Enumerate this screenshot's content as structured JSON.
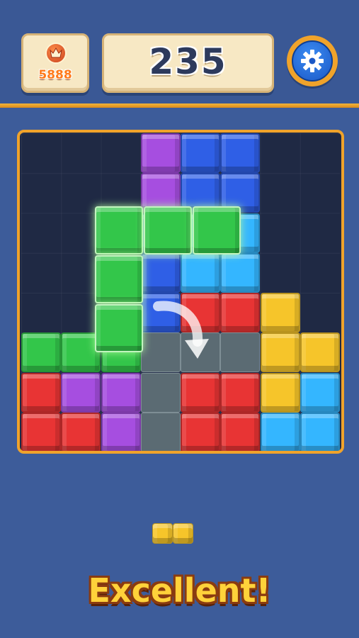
{
  "header": {
    "best_score": "5888",
    "score": "235",
    "crown_icon": "crown-icon",
    "settings_icon": "gear-icon"
  },
  "board": {
    "rows": 8,
    "cols": 8,
    "colors": {
      "purple": "#a64ee0",
      "blue": "#2f5fe6",
      "cyan": "#34b6ff",
      "red": "#e83434",
      "yellow": "#f6c52a",
      "green": "#33c64a"
    },
    "cells": [
      {
        "r": 0,
        "c": 3,
        "color": "purple"
      },
      {
        "r": 0,
        "c": 4,
        "color": "blue"
      },
      {
        "r": 0,
        "c": 5,
        "color": "blue"
      },
      {
        "r": 1,
        "c": 3,
        "color": "purple"
      },
      {
        "r": 1,
        "c": 4,
        "color": "blue"
      },
      {
        "r": 1,
        "c": 5,
        "color": "blue"
      },
      {
        "r": 2,
        "c": 3,
        "color": "blue"
      },
      {
        "r": 2,
        "c": 4,
        "color": "cyan"
      },
      {
        "r": 2,
        "c": 5,
        "color": "cyan"
      },
      {
        "r": 3,
        "c": 3,
        "color": "blue"
      },
      {
        "r": 3,
        "c": 4,
        "color": "cyan"
      },
      {
        "r": 3,
        "c": 5,
        "color": "cyan"
      },
      {
        "r": 4,
        "c": 3,
        "color": "blue"
      },
      {
        "r": 4,
        "c": 4,
        "color": "red"
      },
      {
        "r": 4,
        "c": 5,
        "color": "red"
      },
      {
        "r": 4,
        "c": 6,
        "color": "yellow"
      },
      {
        "r": 5,
        "c": 0,
        "color": "green"
      },
      {
        "r": 5,
        "c": 1,
        "color": "green"
      },
      {
        "r": 5,
        "c": 2,
        "color": "green"
      },
      {
        "r": 5,
        "c": 6,
        "color": "yellow"
      },
      {
        "r": 5,
        "c": 7,
        "color": "yellow"
      },
      {
        "r": 6,
        "c": 0,
        "color": "red"
      },
      {
        "r": 6,
        "c": 1,
        "color": "purple"
      },
      {
        "r": 6,
        "c": 2,
        "color": "purple"
      },
      {
        "r": 6,
        "c": 4,
        "color": "red"
      },
      {
        "r": 6,
        "c": 5,
        "color": "red"
      },
      {
        "r": 6,
        "c": 6,
        "color": "yellow"
      },
      {
        "r": 6,
        "c": 7,
        "color": "cyan"
      },
      {
        "r": 7,
        "c": 0,
        "color": "red"
      },
      {
        "r": 7,
        "c": 1,
        "color": "red"
      },
      {
        "r": 7,
        "c": 2,
        "color": "purple"
      },
      {
        "r": 7,
        "c": 4,
        "color": "red"
      },
      {
        "r": 7,
        "c": 5,
        "color": "red"
      },
      {
        "r": 7,
        "c": 6,
        "color": "cyan"
      },
      {
        "r": 7,
        "c": 7,
        "color": "cyan"
      }
    ],
    "ghost_cells": [
      {
        "r": 5,
        "c": 3
      },
      {
        "r": 5,
        "c": 4
      },
      {
        "r": 5,
        "c": 5
      },
      {
        "r": 6,
        "c": 3
      },
      {
        "r": 7,
        "c": 3
      }
    ]
  },
  "dragging_piece": {
    "color": "green",
    "cells": [
      {
        "r": 0,
        "c": 0
      },
      {
        "r": 0,
        "c": 1
      },
      {
        "r": 0,
        "c": 2
      },
      {
        "r": 1,
        "c": 0
      },
      {
        "r": 2,
        "c": 0
      }
    ]
  },
  "tray": {
    "piece_color": "yellow",
    "cells": [
      {
        "r": 0,
        "c": 0
      },
      {
        "r": 0,
        "c": 1
      }
    ]
  },
  "feedback": {
    "message": "Excellent!"
  }
}
